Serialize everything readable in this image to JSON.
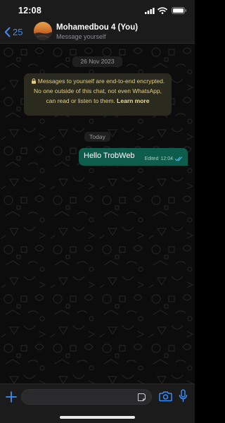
{
  "status_bar": {
    "time": "12:08"
  },
  "header": {
    "back_count": "25",
    "contact_name": "Mohamedbou 4 (You)",
    "contact_subtitle": "Message yourself"
  },
  "chat": {
    "date_separator": "26 Nov 2023",
    "encryption_notice": "Messages to yourself are end-to-end encrypted. No one outside of this chat, not even WhatsApp, can read or listen to them.",
    "learn_more": "Learn more",
    "today_separator": "Today",
    "messages": [
      {
        "text": "Hello TrobWeb",
        "edited_label": "Edited",
        "time": "12:04",
        "status": "read"
      }
    ]
  },
  "input_bar": {
    "placeholder": ""
  },
  "colors": {
    "accent": "#3b8df6",
    "outgoing_bubble": "#0d5c4c",
    "notice_bg": "#2b2a1e",
    "notice_text": "#e7cf7a",
    "read_ticks": "#53bdeb"
  },
  "icons": [
    "signal-icon",
    "wifi-icon",
    "battery-icon",
    "chevron-left-icon",
    "avatar",
    "lock-icon",
    "double-check-icon",
    "plus-icon",
    "sticker-icon",
    "camera-icon",
    "mic-icon"
  ]
}
